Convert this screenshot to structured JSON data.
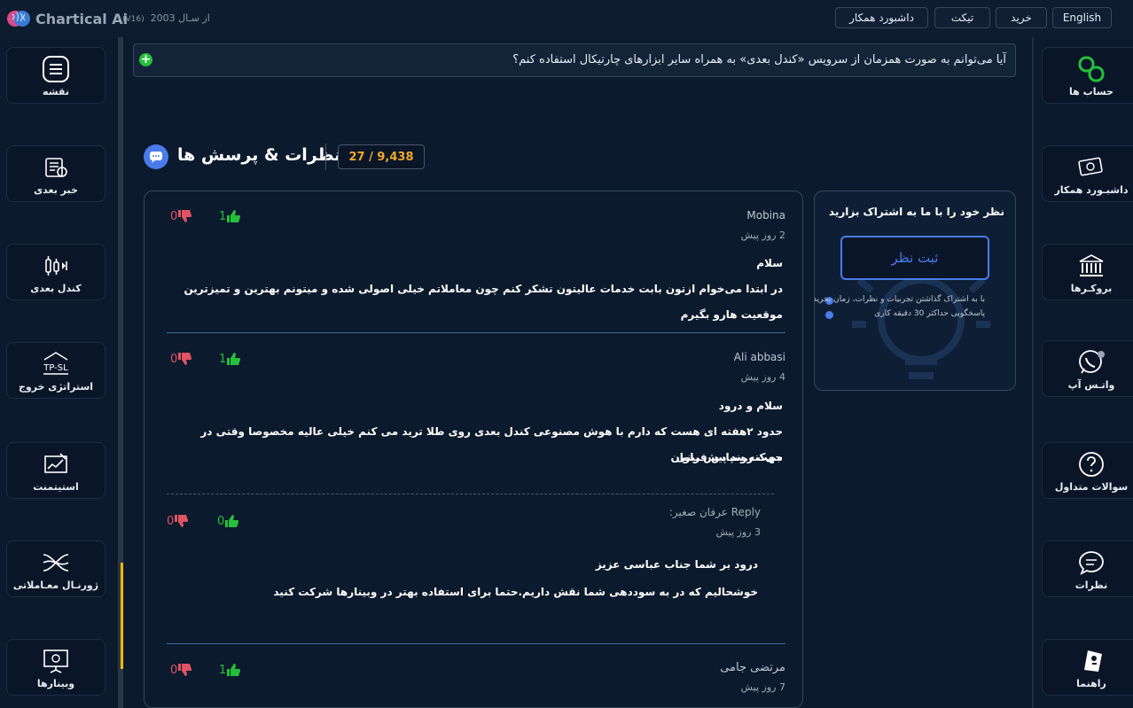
{
  "brand": {
    "name": "Chartical Ai",
    "version": "(V16)",
    "since": "از سـال 2003"
  },
  "topnav": {
    "english": "English",
    "buy": "خرید",
    "ticket": "تیکت",
    "partner_dashboard": "داشبورد همکار"
  },
  "left_sidebar": [
    {
      "label": "نقشه",
      "icon": "menu-icon"
    },
    {
      "label": "خبر بعدی",
      "icon": "news-icon"
    },
    {
      "label": "کندل بعدی",
      "icon": "candle-icon"
    },
    {
      "label": "استراتژی خروج",
      "icon": "tp-sl-icon",
      "icon_text": "TP-SL"
    },
    {
      "label": "استیتمنت",
      "icon": "statement-icon"
    },
    {
      "label": "ژورنـال معـاملاتی",
      "icon": "journal-icon"
    },
    {
      "label": "وبینارها",
      "icon": "webinar-icon"
    }
  ],
  "right_sidebar": [
    {
      "label": "حساب ها",
      "icon": "accounts-icon"
    },
    {
      "label": "داشبـورد همکار",
      "icon": "partner-icon"
    },
    {
      "label": "بروکـرها",
      "icon": "bank-icon"
    },
    {
      "label": "واتـس آپ",
      "icon": "whatsapp-icon"
    },
    {
      "label": "سوالات متداول",
      "icon": "question-icon"
    },
    {
      "label": "نظرات",
      "icon": "chat-icon"
    },
    {
      "label": "راهنما",
      "icon": "guide-icon"
    }
  ],
  "faq": {
    "question": "آیا می‌توانم به صورت همزمان از سرویس «کندل بعدی» به همراه سایر ابزارهای چارتیکال استفاده کنم؟"
  },
  "comments_section": {
    "title": "نظرات & پرسش ها",
    "counter": "27 / 9,438"
  },
  "share": {
    "title": "نظر خود را با ما به اشتراک بزارید",
    "button": "ثبت نظر",
    "notes": [
      "با به اشتراک گذاشتن تجربیات و نظرات، زمان بخرید",
      "پاسخگویی حداکثر 30 دقیقه کاری"
    ]
  },
  "comments": [
    {
      "name": "Mobina",
      "time": "2 روز پیش",
      "greeting": "سلام",
      "body": "در ابتدا می‌خوام ازتون بابت خدمات عالیتون تشکر کنم چون معاملاتم خیلی اصولی شده و میتونم بهترین و تمیزترین موقعیت هارو بگیرم",
      "likes": "1",
      "dislikes": "0"
    },
    {
      "name": "Ali abbasi",
      "time": "4 روز پیش",
      "greeting": "سلام و درود",
      "body": "حدود ۲هفته ای هست که دارم با هوش مصنوعی کندل بعدی روی طلا ترید می کنم خیلی عالیه مخصوصا وقتی در جهت روند پیش بینی",
      "body2": "می‌کنه.سپاس فراوان",
      "likes": "1",
      "dislikes": "0"
    },
    {
      "name": "Reply عرفان صغیر:",
      "time": "3 روز پیش",
      "greeting": "درود بر شما جناب عباسی عزیز",
      "body": "خوشحالیم که در به سوددهی شما نقش داریم.حتما برای استفاده بهتر در وبینارها شرکت کنید",
      "likes": "0",
      "dislikes": "0"
    },
    {
      "name": "مرتضی جامی",
      "time": "7 روز پیش",
      "likes": "1",
      "dislikes": "0"
    }
  ]
}
